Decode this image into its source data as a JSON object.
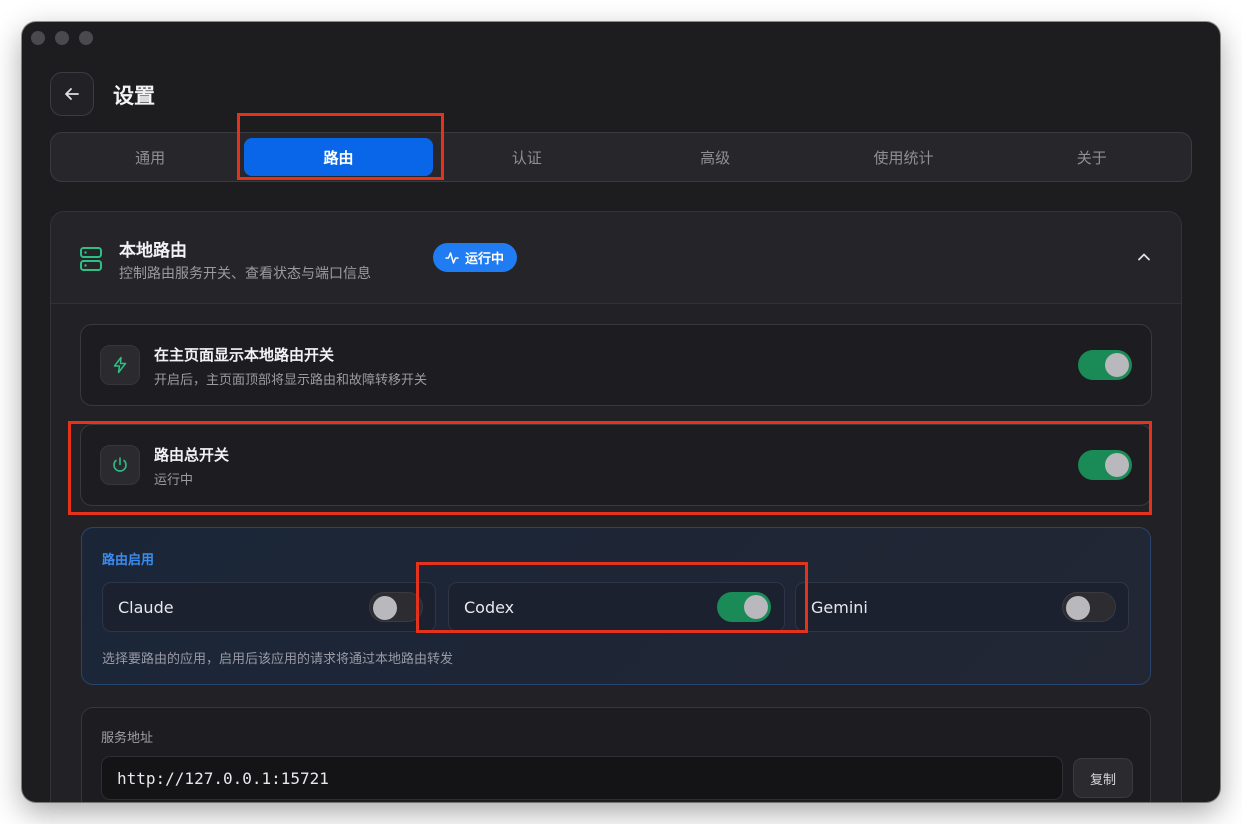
{
  "header": {
    "title": "设置"
  },
  "tabs": [
    {
      "label": "通用",
      "active": false
    },
    {
      "label": "路由",
      "active": true
    },
    {
      "label": "认证",
      "active": false
    },
    {
      "label": "高级",
      "active": false
    },
    {
      "label": "使用统计",
      "active": false
    },
    {
      "label": "关于",
      "active": false
    }
  ],
  "local_routing": {
    "title": "本地路由",
    "subtitle": "控制路由服务开关、查看状态与端口信息",
    "status": "运行中",
    "icon": "server-icon"
  },
  "show_toggle_row": {
    "title": "在主页面显示本地路由开关",
    "desc": "开启后，主页面顶部将显示路由和故障转移开关",
    "enabled": true,
    "icon": "lightning-icon"
  },
  "master_switch_row": {
    "title": "路由总开关",
    "desc": "运行中",
    "enabled": true,
    "icon": "power-icon"
  },
  "routing_enable": {
    "title": "路由启用",
    "apps": [
      {
        "name": "Claude",
        "enabled": false
      },
      {
        "name": "Codex",
        "enabled": true
      },
      {
        "name": "Gemini",
        "enabled": false
      }
    ],
    "hint": "选择要路由的应用，启用后该应用的请求将通过本地路由转发"
  },
  "service_address": {
    "label": "服务地址",
    "value": "http://127.0.0.1:15721",
    "copy_label": "复制"
  },
  "colors": {
    "accent": "#0a66e8",
    "toggle_on": "#1a8a57",
    "highlight": "#e5321d",
    "routing_label": "#3b8cf0"
  }
}
